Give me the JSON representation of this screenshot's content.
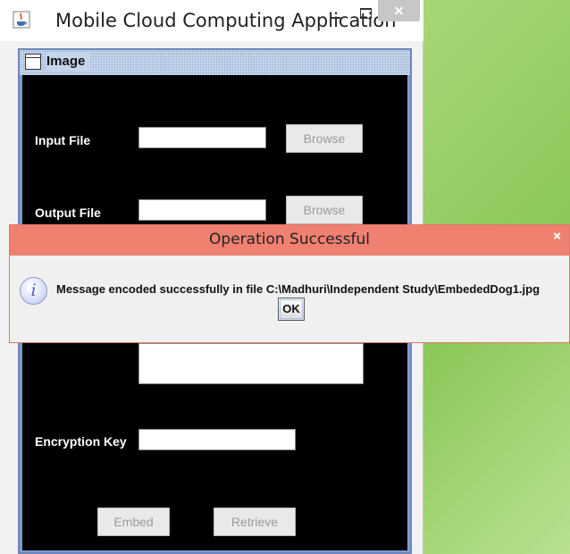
{
  "window": {
    "title": "Mobile Cloud Computing Application",
    "inner_frame_title": "Image"
  },
  "form": {
    "input_file_label": "Input File",
    "input_file_value": "",
    "input_browse_label": "Browse",
    "output_file_label": "Output File",
    "output_file_value": "",
    "output_browse_label": "Browse",
    "message_value": "",
    "encryption_key_label": "Encryption Key",
    "encryption_key_value": "",
    "embed_label": "Embed",
    "retrieve_label": "Retrieve"
  },
  "dialog": {
    "title": "Operation Successful",
    "message": "Message encoded successfully in file C:\\Madhuri\\Independent Study\\EmbededDog1.jpg",
    "ok_label": "OK",
    "icon": "info-icon"
  },
  "colors": {
    "dialog_titlebar": "#f08070",
    "panel_background": "#000000",
    "desktop": "#a9d879"
  }
}
